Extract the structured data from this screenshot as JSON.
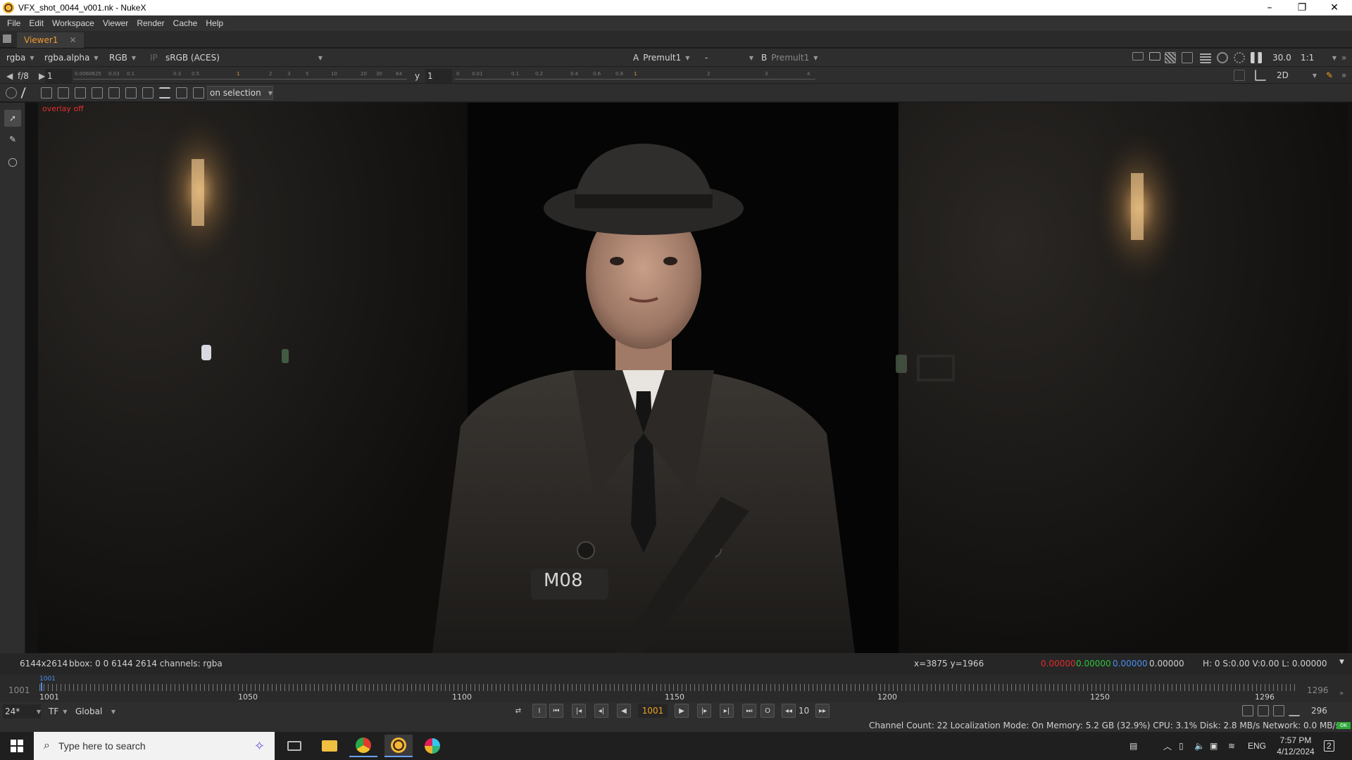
{
  "window": {
    "title": "VFX_shot_0044_v001.nk - NukeX",
    "controls": [
      "–",
      "❐",
      "✕"
    ]
  },
  "menu": [
    "File",
    "Edit",
    "Workspace",
    "Viewer",
    "Render",
    "Cache",
    "Help"
  ],
  "tabs": [
    {
      "label": "Viewer1",
      "close": "✕"
    }
  ],
  "viewer_toolbar": {
    "channels": "rgba",
    "alpha_channel": "rgba.alpha",
    "display": "RGB",
    "ip": "IP",
    "colorspace": "sRGB (ACES)",
    "input_a_label": "A",
    "input_a": "Premult1",
    "wipe_mode": "-",
    "input_b_label": "B",
    "input_b": "Premult1",
    "fps": "30.0",
    "zoom": "1:1"
  },
  "exposure_bar": {
    "fstop": "f/8",
    "gain_value": "1",
    "gamma_label": "y",
    "gamma_value": "1",
    "gain_ticks": [
      "0.0060625",
      "0.03",
      "0.1",
      "0.3",
      "0.5",
      "1",
      "2",
      "3",
      "5",
      "10",
      "20",
      "30",
      "64"
    ],
    "gamma_ticks": [
      "0",
      "0.01",
      "0.1",
      "0.2",
      "0.4",
      "0.6",
      "0.8",
      "1",
      "2",
      "3",
      "4"
    ],
    "view_mode": "2D"
  },
  "transform_toolbar": {
    "selection_mode": "on selection"
  },
  "viewer": {
    "overlay_label": "overlay off",
    "patch_text": "M08"
  },
  "info_bar": {
    "format": "6144x2614",
    "bbox": "bbox: 0 0 6144 2614 channels: rgba",
    "coords": "x=3875 y=1966",
    "r": "0.00000",
    "g": "0.00000",
    "b": "0.00000",
    "a": "0.00000",
    "hsv": "H:  0 S:0.00 V:0.00  L: 0.00000",
    "colors": {
      "r": "#e02c2c",
      "g": "#2fc43a",
      "b": "#4a8ef0"
    }
  },
  "timeline": {
    "in_frame": "1001",
    "out_frame": "1296",
    "current_marker": "1001",
    "labels": [
      "1001",
      "1050",
      "1100",
      "1150",
      "1200",
      "1250",
      "1296"
    ]
  },
  "playback": {
    "fps": "24*",
    "tf": "TF",
    "scope": "Global",
    "current_frame": "1001",
    "increment": "10",
    "frame_count": "296"
  },
  "status": {
    "text": "Channel Count: 22  Localization Mode: On  Memory: 5.2 GB (32.9%)  CPU: 3.1%  Disk: 2.8 MB/s  Network: 0.0 MB/s",
    "ok": "OK"
  },
  "taskbar": {
    "search_placeholder": "Type here to search",
    "language": "ENG",
    "time": "7:57 PM",
    "date": "4/12/2024",
    "notifications": "2"
  }
}
